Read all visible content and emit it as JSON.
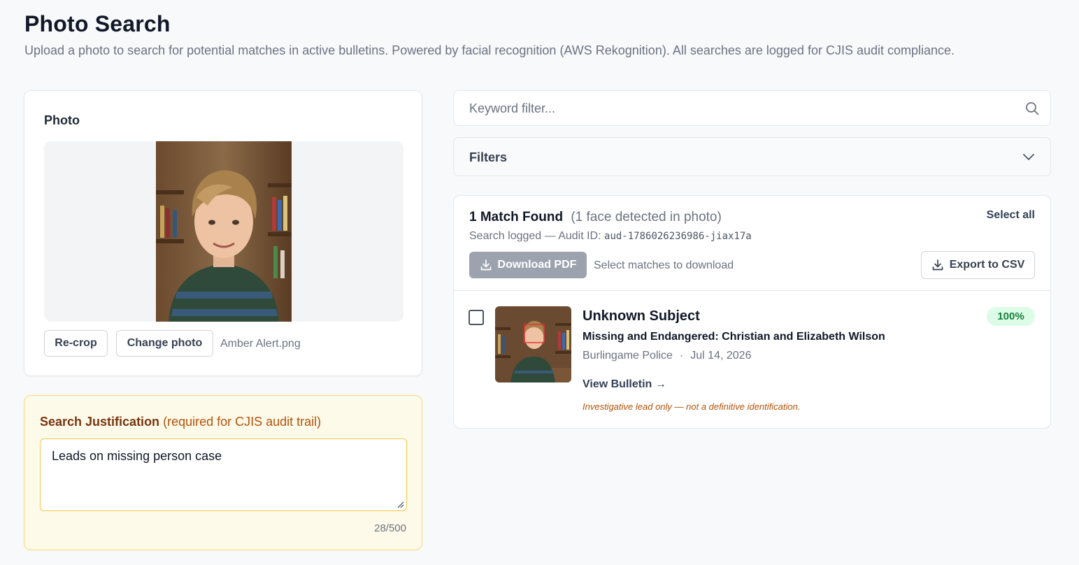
{
  "page": {
    "title": "Photo Search",
    "subtitle": "Upload a photo to search for potential matches in active bulletins. Powered by facial recognition (AWS Rekognition). All searches are logged for CJIS audit compliance."
  },
  "photo_card": {
    "label": "Photo",
    "recrop_label": "Re-crop",
    "change_label": "Change photo",
    "file_name": "Amber Alert.png"
  },
  "justification": {
    "title": "Search Justification",
    "hint": "(required for CJIS audit trail)",
    "value": "Leads on missing person case",
    "char_count": "28/500"
  },
  "search": {
    "placeholder": "Keyword filter..."
  },
  "filters": {
    "label": "Filters"
  },
  "results": {
    "heading": "1 Match Found",
    "faces_detected": "(1 face detected in photo)",
    "select_all": "Select all",
    "audit_prefix": "Search logged — Audit ID:",
    "audit_id": "aud-1786026236986-jiax17a",
    "download_label": "Download PDF",
    "download_hint": "Select matches to download",
    "export_label": "Export to CSV",
    "items": [
      {
        "name": "Unknown Subject",
        "bulletin": "Missing and Endangered: Christian and Elizabeth Wilson",
        "agency": "Burlingame Police",
        "separator": "·",
        "date": "Jul 14, 2026",
        "view_link": "View Bulletin →",
        "disclaimer": "Investigative lead only — not a definitive identification.",
        "score": "100%",
        "checked": false
      }
    ]
  },
  "colors": {
    "download_disabled": "#9ca3af",
    "badge_bg": "#dcfce7",
    "badge_text": "#15803d",
    "justification_bg": "#fefaea",
    "justification_border": "#f8d877"
  }
}
